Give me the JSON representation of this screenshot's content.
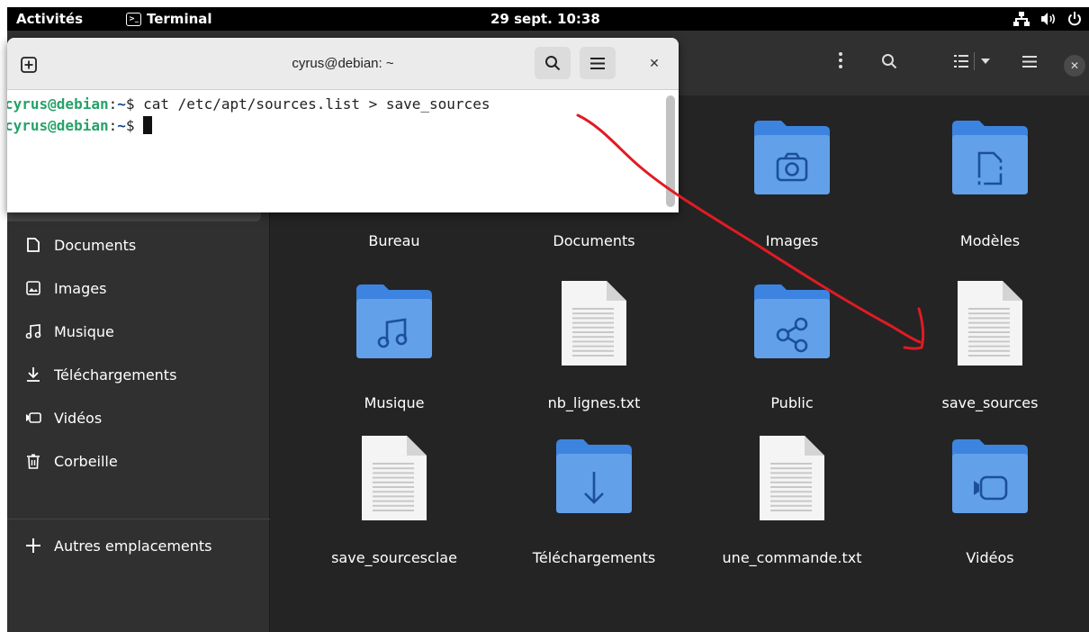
{
  "topbar": {
    "activities": "Activités",
    "app_name": "Terminal",
    "app_icon": ">_",
    "clock": "29 sept.  10:38",
    "status_icons": [
      "network-icon",
      "volume-icon",
      "power-icon"
    ]
  },
  "terminal": {
    "title": "cyrus@debian: ~",
    "lines": [
      {
        "user": "cyrus@debian",
        "sep": ":",
        "path": "~",
        "prompt_end": "$ ",
        "command": "cat /etc/apt/sources.list > save_sources"
      },
      {
        "user": "cyrus@debian",
        "sep": ":",
        "path": "~",
        "prompt_end": "$ ",
        "command": ""
      }
    ]
  },
  "files": {
    "sidebar": [
      {
        "label": "Documents",
        "icon": "document-icon"
      },
      {
        "label": "Images",
        "icon": "image-icon"
      },
      {
        "label": "Musique",
        "icon": "music-icon"
      },
      {
        "label": "Téléchargements",
        "icon": "download-icon"
      },
      {
        "label": "Vidéos",
        "icon": "video-icon"
      },
      {
        "label": "Corbeille",
        "icon": "trash-icon"
      },
      {
        "label": "Autres emplacements",
        "icon": "plus-icon"
      }
    ],
    "items": [
      {
        "name": "Bureau",
        "type": "folder",
        "emblem": ""
      },
      {
        "name": "Documents",
        "type": "folder",
        "emblem": ""
      },
      {
        "name": "Images",
        "type": "folder",
        "emblem": "camera"
      },
      {
        "name": "Modèles",
        "type": "folder",
        "emblem": "template"
      },
      {
        "name": "Musique",
        "type": "folder",
        "emblem": "music"
      },
      {
        "name": "nb_lignes.txt",
        "type": "text",
        "emblem": ""
      },
      {
        "name": "Public",
        "type": "folder",
        "emblem": "share"
      },
      {
        "name": "save_sources",
        "type": "text",
        "emblem": ""
      },
      {
        "name": "save_sourcesclae",
        "type": "text",
        "emblem": ""
      },
      {
        "name": "Téléchargements",
        "type": "folder",
        "emblem": "download"
      },
      {
        "name": "une_commande.txt",
        "type": "text",
        "emblem": ""
      },
      {
        "name": "Vidéos",
        "type": "folder",
        "emblem": "video"
      }
    ]
  },
  "colors": {
    "folder_back": "#3d84e0",
    "folder_front": "#62a0ea",
    "prompt_user": "#26a269",
    "prompt_path": "#12488b",
    "annotation": "#e01b24"
  }
}
